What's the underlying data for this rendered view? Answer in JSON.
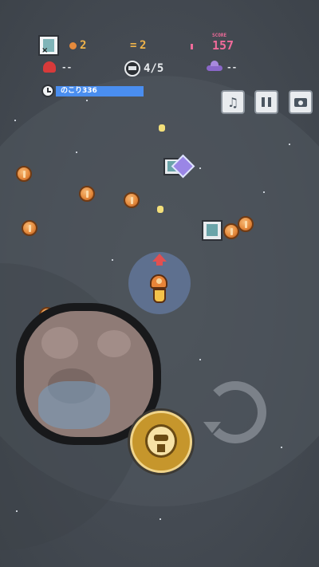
{
  "hud": {
    "coins": "2",
    "kills": "2",
    "score_label": "SCORE",
    "score": "157",
    "red_enemy_count": "--",
    "crew_count": "4/5",
    "ufo_count": "--",
    "timer_label": "のこり336",
    "timer_progress": 1.0
  },
  "controls": {
    "music_icon": "music-note-icon",
    "pause_icon": "pause-icon",
    "camera_icon": "camera-icon"
  },
  "colors": {
    "score": "#f06b9a",
    "progress": "#3e78d6",
    "coin": "#e58a3c",
    "asteroid": "#8f7b76",
    "action_button": "#c6962c"
  }
}
